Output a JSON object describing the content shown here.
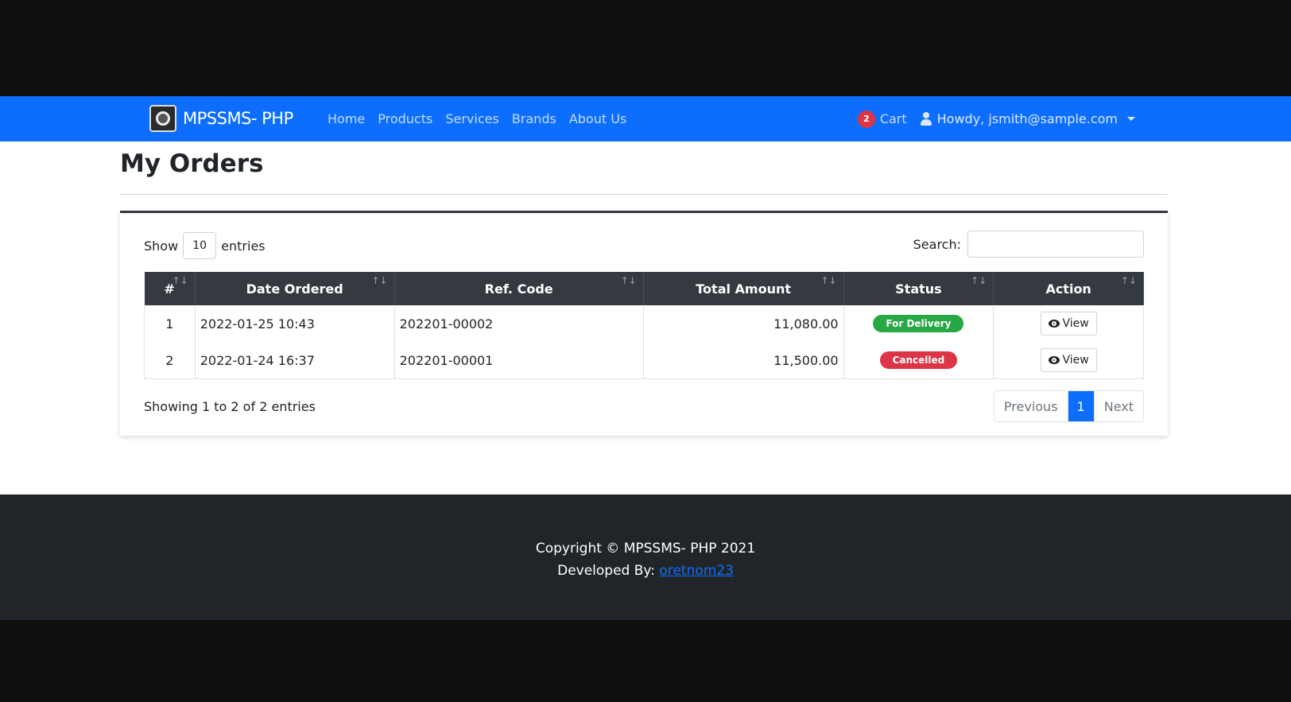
{
  "brand": {
    "name": "MPSSMS- PHP"
  },
  "nav": {
    "links": [
      "Home",
      "Products",
      "Services",
      "Brands",
      "About Us"
    ],
    "cart_label": "Cart",
    "cart_count": "2",
    "user_label": "Howdy, jsmith@sample.com"
  },
  "page": {
    "title": "My Orders"
  },
  "table_controls": {
    "show_label": "Show",
    "entries_value": "10",
    "entries_label": "entries",
    "search_label": "Search:"
  },
  "table": {
    "headers": [
      "#",
      "Date Ordered",
      "Ref. Code",
      "Total Amount",
      "Status",
      "Action"
    ],
    "rows": [
      {
        "num": "1",
        "date": "2022-01-25 10:43",
        "ref": "202201-00002",
        "amount": "11,080.00",
        "status": "For Delivery",
        "action": "View"
      },
      {
        "num": "2",
        "date": "2022-01-24 16:37",
        "ref": "202201-00001",
        "amount": "11,500.00",
        "status": "Cancelled",
        "action": "View"
      }
    ]
  },
  "status_colors": {
    "for_delivery": "#28a745",
    "cancelled": "#dc3545"
  },
  "pagination": {
    "info": "Showing 1 to 2 of 2 entries",
    "previous": "Previous",
    "current": "1",
    "next": "Next"
  },
  "footer": {
    "copyright": "Copyright © MPSSMS- PHP 2021",
    "developed_by": "Developed By:",
    "developer": "oretnom23"
  },
  "colors": {
    "navbar": "#0d6efd",
    "footer": "#212529",
    "header_dark": "#343a40"
  }
}
